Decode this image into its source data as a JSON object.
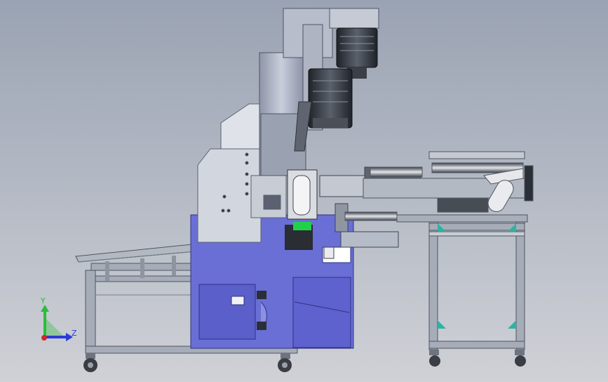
{
  "viewport": {
    "background_top": "#9aa3b3",
    "background_bottom": "#cfd1d6"
  },
  "colors": {
    "frame": "#9fa6b1",
    "frame_dark": "#5c6370",
    "cabinet_blue": "#6a6fd6",
    "cabinet_dark": "#3c3f9a",
    "housing_light": "#d8dbe2",
    "motor_dark": "#2b2f36",
    "highlight_green": "#22d04a",
    "teal": "#2fb3a1"
  },
  "triad": {
    "y_label": "Y",
    "z_label": "Z",
    "y_color": "#2bbd3a",
    "z_color": "#2b3bd6",
    "x_color": "#d22a2a"
  }
}
